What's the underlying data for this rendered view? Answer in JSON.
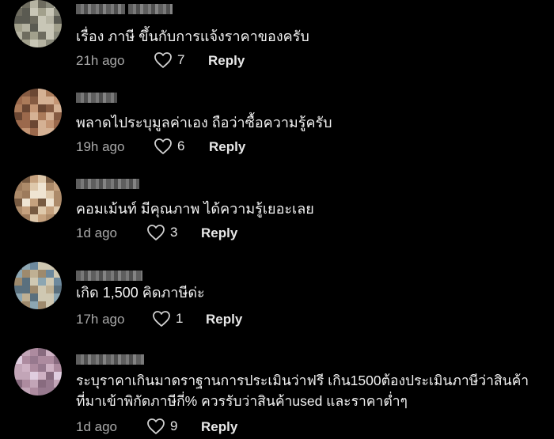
{
  "comments": [
    {
      "text_lines": [
        "เรื่อง ภาษี ขึ้นกับการแจ้งราคาของครับ"
      ],
      "time": "21h ago",
      "likes": "7",
      "reply_label": "Reply",
      "avatar_colors": [
        "#8a8a7a",
        "#a2a08a",
        "#6e6c5e",
        "#b5b3a0",
        "#5a5a50",
        "#c8c6b4"
      ]
    },
    {
      "text_lines": [
        "พลาดไประบุมูลค่าเอง ถือว่าซื้อความรู้ครับ"
      ],
      "time": "19h ago",
      "likes": "6",
      "reply_label": "Reply",
      "avatar_colors": [
        "#8a5a3e",
        "#b07a56",
        "#6e4630",
        "#c89470",
        "#a06848",
        "#d8b090"
      ]
    },
    {
      "text_lines": [
        "คอมเม้นท์ มีคุณภาพ ได้ความรู้เยอะเลย"
      ],
      "time": "1d ago",
      "likes": "3",
      "reply_label": "Reply",
      "avatar_colors": [
        "#a07a58",
        "#c8a07a",
        "#e0c8a8",
        "#7a5a3e",
        "#f0e4d0",
        "#b08a66"
      ]
    },
    {
      "text_lines": [
        "เกิด 1,500 คิดภาษีด่ะ"
      ],
      "time": "17h ago",
      "likes": "1",
      "reply_label": "Reply",
      "avatar_colors": [
        "#6a8aa0",
        "#8aa6b4",
        "#a08a6a",
        "#c0b090",
        "#587080",
        "#d0c8b0"
      ]
    },
    {
      "text_lines": [
        "ระบุราคาเกินมาดราฐานการประเมินว่าฟรี เกิน1500ต้องประเมินภาษีว่าสินค้า",
        "ที่มาเข้าพิกัดภาษีกี่% ควรรับว่าสินค้าused และราคาต่ำๆ"
      ],
      "time": "1d ago",
      "likes": "9",
      "reply_label": "Reply",
      "avatar_colors": [
        "#b08aa0",
        "#d0b0c4",
        "#8a6a80",
        "#e0cce0",
        "#9a7890",
        "#c4a4b8"
      ]
    }
  ],
  "colors": {
    "background": "#000000",
    "text": "#f2f2f2",
    "meta": "#a8a8a8",
    "reply": "#e8e8e8"
  },
  "icons": {
    "like": "heart-outline-icon"
  }
}
